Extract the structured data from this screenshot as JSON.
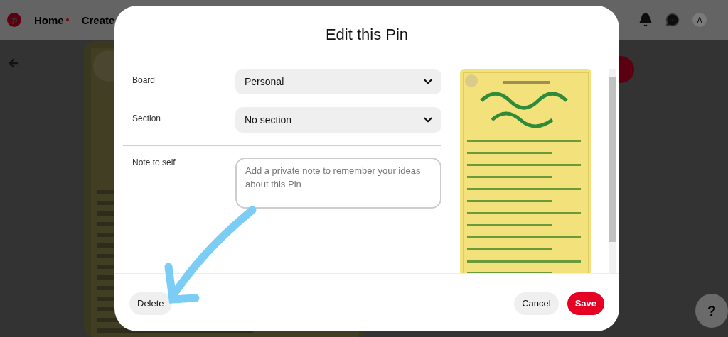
{
  "header": {
    "nav": [
      {
        "label": "Home",
        "notification_dot": true
      },
      {
        "label": "Create",
        "notification_dot": false
      }
    ],
    "avatar": "A"
  },
  "help_button": "?",
  "modal": {
    "title": "Edit this Pin",
    "fields": [
      {
        "kind": "dropdown",
        "label": "Board",
        "value": "Personal"
      },
      {
        "kind": "dropdown",
        "label": "Section",
        "value": "No section"
      },
      {
        "kind": "textarea",
        "label": "Note to self",
        "placeholder": "Add a private note to remember your ideas about this Pin"
      }
    ],
    "buttons": [
      {
        "label": "Delete",
        "kind": "secondary"
      },
      {
        "label": "Cancel",
        "kind": "secondary"
      },
      {
        "label": "Save",
        "kind": "primary"
      }
    ]
  }
}
